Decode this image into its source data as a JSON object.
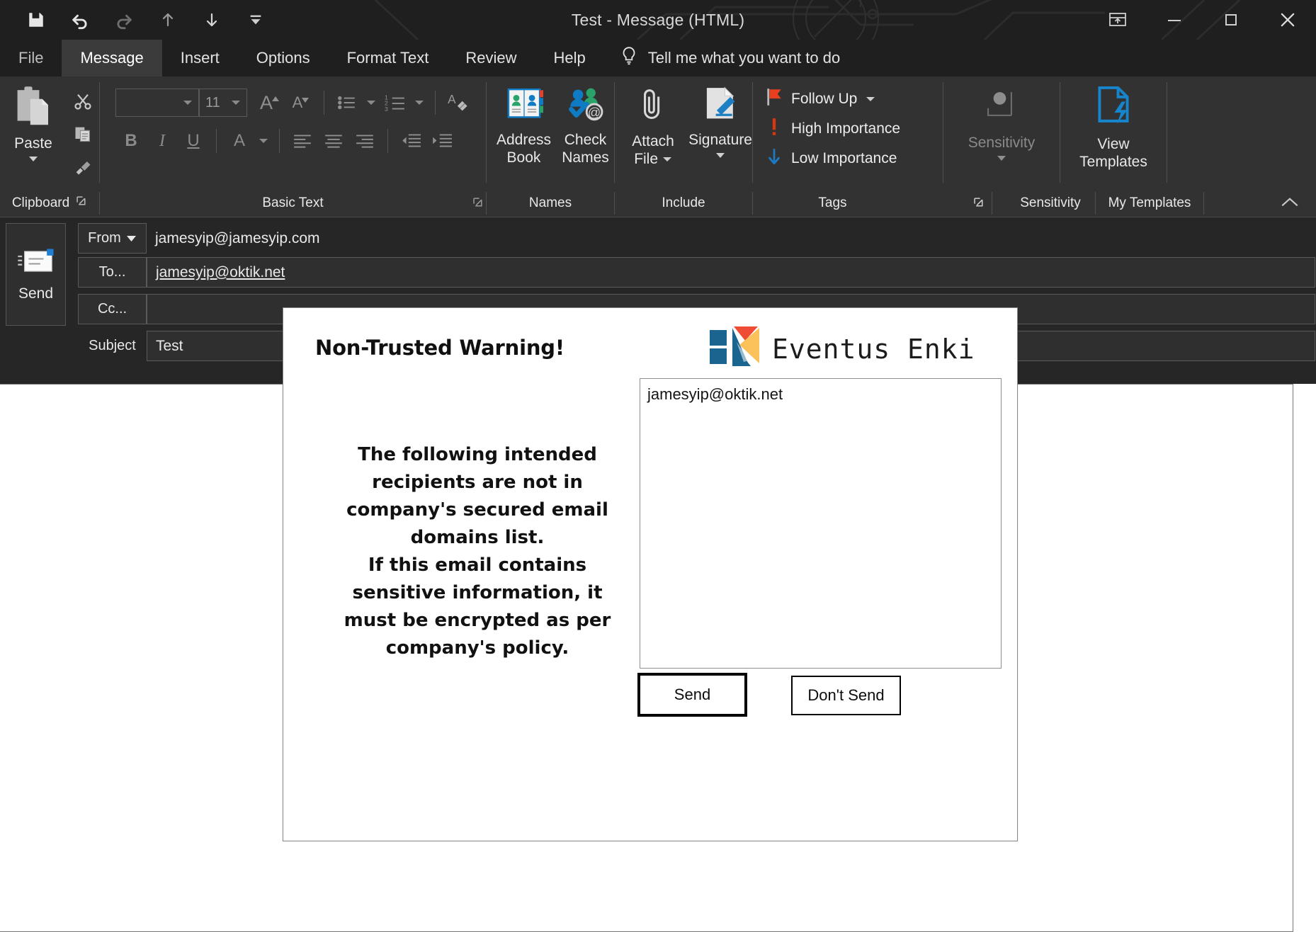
{
  "window": {
    "title": "Test  -  Message (HTML)",
    "quick_access": [
      "save-icon",
      "undo-icon",
      "redo-icon",
      "up-arrow-icon",
      "down-arrow-icon",
      "customize-qat-icon"
    ],
    "controls": [
      "ribbon-display-options",
      "minimize",
      "maximize",
      "close"
    ]
  },
  "tabs": [
    {
      "label": "File",
      "active": false,
      "dim": true
    },
    {
      "label": "Message",
      "active": true,
      "dim": false
    },
    {
      "label": "Insert",
      "active": false,
      "dim": false
    },
    {
      "label": "Options",
      "active": false,
      "dim": false
    },
    {
      "label": "Format Text",
      "active": false,
      "dim": false
    },
    {
      "label": "Review",
      "active": false,
      "dim": false
    },
    {
      "label": "Help",
      "active": false,
      "dim": false
    }
  ],
  "tell_me": {
    "label": "Tell me what you want to do",
    "icon": "lightbulb-icon"
  },
  "ribbon": {
    "clipboard": {
      "group_label": "Clipboard",
      "paste_label": "Paste",
      "cut_label": "Cut",
      "copy_label": "Copy",
      "format_painter_label": "Format Painter",
      "has_dialog_launcher": true
    },
    "basic_text": {
      "group_label": "Basic Text",
      "font_name": "",
      "font_size": "11",
      "grow_font": "A",
      "shrink_font": "A",
      "bold": "B",
      "italic": "I",
      "underline": "U",
      "text_highlight": "A",
      "has_dialog_launcher": true
    },
    "names": {
      "group_label": "Names",
      "address_book": "Address\nBook",
      "address_book_line1": "Address",
      "address_book_line2": "Book",
      "check_names_line1": "Check",
      "check_names_line2": "Names"
    },
    "include": {
      "group_label": "Include",
      "attach_file_line1": "Attach",
      "attach_file_line2": "File",
      "signature_label": "Signature"
    },
    "tags": {
      "group_label": "Tags",
      "follow_up": "Follow Up",
      "high_importance": "High Importance",
      "low_importance": "Low Importance",
      "has_dialog_launcher": true
    },
    "sensitivity": {
      "group_label": "Sensitivity",
      "button_label": "Sensitivity",
      "disabled": true
    },
    "my_templates": {
      "group_label": "My Templates",
      "view_templates_line1": "View",
      "view_templates_line2": "Templates"
    },
    "collapse_label": "collapse-ribbon-icon"
  },
  "compose": {
    "send_label": "Send",
    "from_label": "From",
    "from_value": "jamesyip@jamesyip.com",
    "to_label": "To...",
    "to_value": "jamesyip@oktik.net",
    "cc_label": "Cc...",
    "cc_value": "",
    "subject_label": "Subject",
    "subject_value": "Test",
    "body_value": ""
  },
  "dialog": {
    "title": "Non-Trusted Warning!",
    "brand": "Eventus Enki",
    "message": "The following intended recipients are not in company's secured email domains list.\nIf this email contains sensitive information, it must be encrypted as per company's policy.",
    "message_line1": "The following intended recipients are not in company's secured email domains list.",
    "message_line2": "If this email contains sensitive information, it must be encrypted as per company's policy.",
    "recipients": [
      "jamesyip@oktik.net"
    ],
    "send_button": "Send",
    "dont_send_button": "Don't Send"
  },
  "colors": {
    "titlebar_bg": "#1f1f1f",
    "ribbon_bg": "#323232",
    "compose_bg": "#262626",
    "active_tab_bg": "#3b3b3b",
    "accent_blue": "#0f7bc4",
    "logo_blue": "#1a6490",
    "logo_red": "#f04b35",
    "logo_orange": "#fbc15a",
    "flag_red": "#e8401f",
    "importance_red": "#d8380f",
    "importance_blue": "#1e7ac0",
    "text_light": "#e8e8e8",
    "text_dim": "#9b9b9b"
  }
}
